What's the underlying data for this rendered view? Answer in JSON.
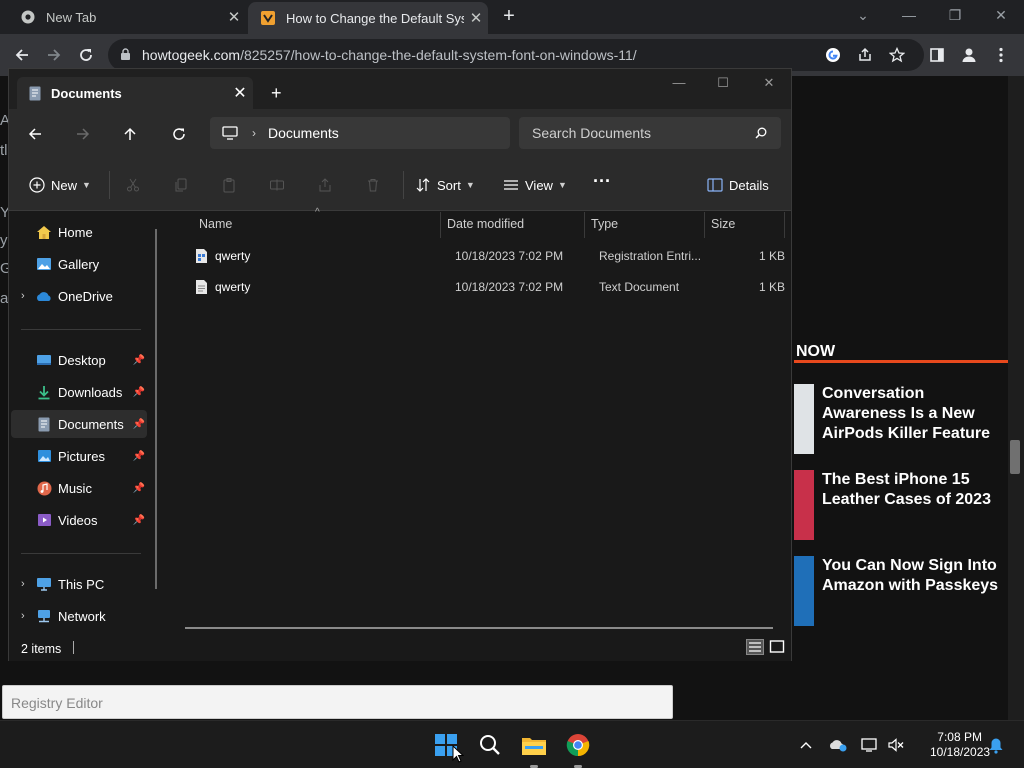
{
  "chrome": {
    "tabs": [
      {
        "title": "New Tab"
      },
      {
        "title": "How to Change the Default System"
      }
    ],
    "url_host": "howtogeek.com",
    "url_path": "/825257/how-to-change-the-default-system-font-on-windows-11/"
  },
  "webpage": {
    "section_label": "NOW",
    "articles": [
      {
        "title": "Conversation Awareness Is a New AirPods Killer Feature (Here's How to..."
      },
      {
        "title": "The Best iPhone 15 Leather Cases of 2023"
      },
      {
        "title": "You Can Now Sign Into Amazon with Passkeys"
      }
    ],
    "left_letters": [
      "A",
      "tl",
      "Y",
      "y",
      "G",
      "a"
    ]
  },
  "explorer": {
    "tab_title": "Documents",
    "breadcrumb": "Documents",
    "search_placeholder": "Search Documents",
    "toolbar": {
      "new_label": "New",
      "sort_label": "Sort",
      "view_label": "View",
      "more_label": "···",
      "details_label": "Details"
    },
    "sidebar": {
      "items": [
        {
          "label": "Home",
          "icon": "home-icon"
        },
        {
          "label": "Gallery",
          "icon": "gallery-icon"
        },
        {
          "label": "OneDrive",
          "icon": "onedrive-icon"
        },
        {
          "label": "Desktop",
          "icon": "desktop-icon"
        },
        {
          "label": "Downloads",
          "icon": "downloads-icon"
        },
        {
          "label": "Documents",
          "icon": "documents-icon"
        },
        {
          "label": "Pictures",
          "icon": "pictures-icon"
        },
        {
          "label": "Music",
          "icon": "music-icon"
        },
        {
          "label": "Videos",
          "icon": "videos-icon"
        },
        {
          "label": "This PC",
          "icon": "this-pc-icon"
        },
        {
          "label": "Network",
          "icon": "network-icon"
        }
      ]
    },
    "columns": [
      "Name",
      "Date modified",
      "Type",
      "Size"
    ],
    "files": [
      {
        "name": "qwerty",
        "date": "10/18/2023 7:02 PM",
        "type": "Registration Entri...",
        "size": "1 KB"
      },
      {
        "name": "qwerty",
        "date": "10/18/2023 7:02 PM",
        "type": "Text Document",
        "size": "1 KB"
      }
    ],
    "status": "2 items"
  },
  "search_bar": {
    "value": "Registry Editor"
  },
  "taskbar": {
    "time": "7:08 PM",
    "date": "10/18/2023"
  }
}
